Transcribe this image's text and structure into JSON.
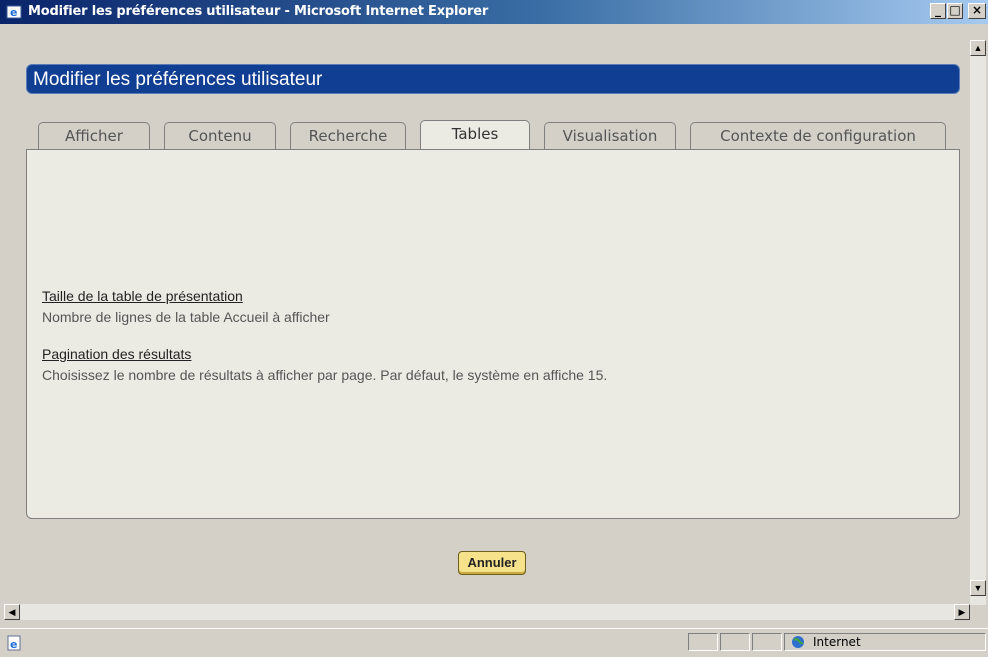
{
  "window": {
    "title": "Modifier les préférences utilisateur - Microsoft Internet Explorer",
    "controls": {
      "minimize": "_",
      "maximize": "□",
      "close": "×"
    }
  },
  "page": {
    "title": "Modifier les préférences utilisateur"
  },
  "tabs": [
    {
      "label": "Afficher",
      "active": false
    },
    {
      "label": "Contenu",
      "active": false
    },
    {
      "label": "Recherche",
      "active": false
    },
    {
      "label": "Tables",
      "active": true
    },
    {
      "label": "Visualisation",
      "active": false
    },
    {
      "label": "Contexte de configuration",
      "active": false
    }
  ],
  "settings": [
    {
      "link": "Taille de la table de présentation",
      "description": "Nombre de lignes de la table Accueil à afficher"
    },
    {
      "link": "Pagination des résultats",
      "description": "Choisissez le nombre de résultats à afficher par page. Par défaut, le système en affiche 15."
    }
  ],
  "buttons": {
    "cancel": "Annuler"
  },
  "statusbar": {
    "zone": "Internet"
  },
  "icons": {
    "window": "ie-window-icon",
    "page": "ie-page-icon",
    "zone": "internet-globe-icon"
  },
  "colors": {
    "header_bg": "#0f3e92",
    "titlebar_start": "#0a246a",
    "titlebar_end": "#a6caf0",
    "panel_bg": "#ecebe3",
    "button_bg": "#f6e28a"
  }
}
